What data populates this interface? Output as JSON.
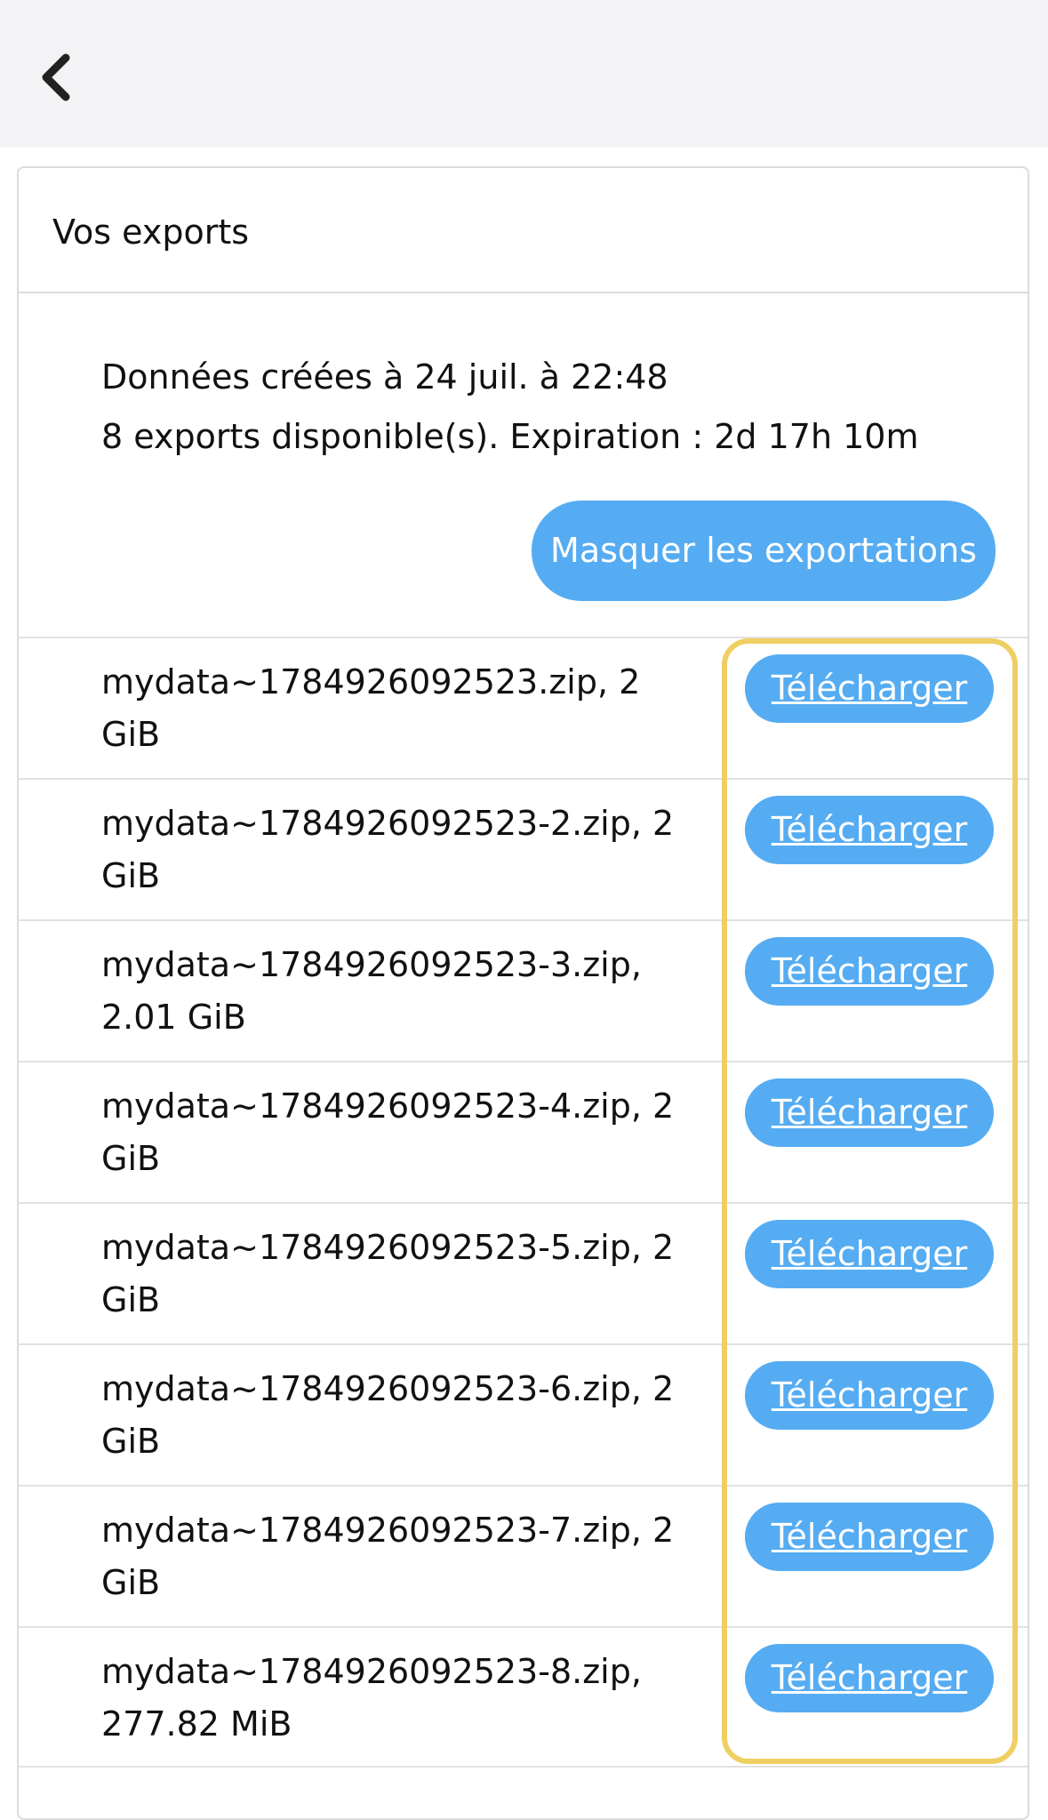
{
  "nav": {
    "back_icon": "chevron-left-icon"
  },
  "card": {
    "title": "Vos exports",
    "created_text": "Données créées à 24 juil. à 22:48",
    "available_text": "8 exports disponible(s). Expiration : 2d 17h 10m",
    "toggle_label": "Masquer les exportations"
  },
  "exports": [
    {
      "name": "mydata~1784926092523.zip, 2 GiB",
      "download_label": "Télécharger"
    },
    {
      "name": "mydata~1784926092523-2.zip, 2 GiB",
      "download_label": "Télécharger"
    },
    {
      "name": "mydata~1784926092523-3.zip, 2.01 GiB",
      "download_label": "Télécharger"
    },
    {
      "name": "mydata~1784926092523-4.zip, 2 GiB",
      "download_label": "Télécharger"
    },
    {
      "name": "mydata~1784926092523-5.zip, 2 GiB",
      "download_label": "Télécharger"
    },
    {
      "name": "mydata~1784926092523-6.zip, 2 GiB",
      "download_label": "Télécharger"
    },
    {
      "name": "mydata~1784926092523-7.zip, 2 GiB",
      "download_label": "Télécharger"
    },
    {
      "name": "mydata~1784926092523-8.zip, 277.82 MiB",
      "download_label": "Télécharger"
    }
  ],
  "colors": {
    "button_blue": "#55acf2",
    "highlight_yellow": "#efcf62",
    "topbar_gray": "#f3f3f5"
  }
}
